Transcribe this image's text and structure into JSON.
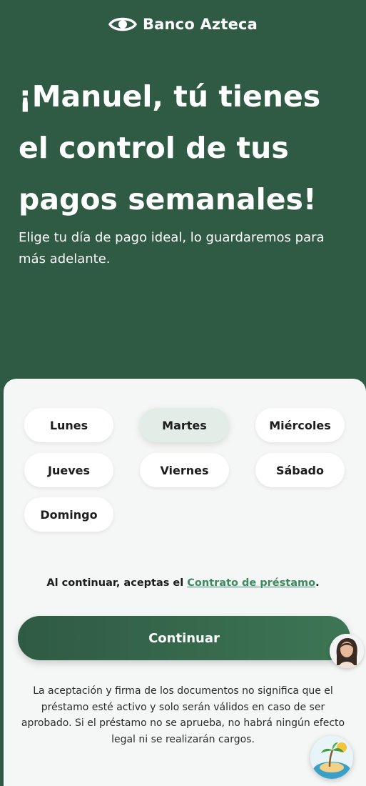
{
  "header": {
    "brand": "Banco Azteca",
    "headline": "¡Manuel, tú tienes el control de tus pagos semanales!",
    "subtitle": "Elige tu día de pago ideal, lo guardaremos para más adelante."
  },
  "days": {
    "selected": "Martes",
    "items": [
      "Lunes",
      "Martes",
      "Miércoles",
      "Jueves",
      "Viernes",
      "Sábado",
      "Domingo"
    ]
  },
  "consent": {
    "prefix": "Al continuar, aceptas el ",
    "link": "Contrato de préstamo",
    "suffix": "."
  },
  "continue_label": "Continuar",
  "disclaimer": "La aceptación y firma de los documentos no significa que el préstamo esté activo y solo serán válidos en caso de ser aprobado. Si el préstamo no se aprueba, no habrá ningún efecto legal ni se realizarán cargos.",
  "colors": {
    "brand_green": "#2f5a43",
    "link_green": "#3b8a5f",
    "selected_day": "#e3ede8",
    "card_bg": "#f5f7f6"
  },
  "icons": [
    "banco-azteca-logo-icon",
    "assistant-avatar-icon",
    "island-badge-icon"
  ]
}
